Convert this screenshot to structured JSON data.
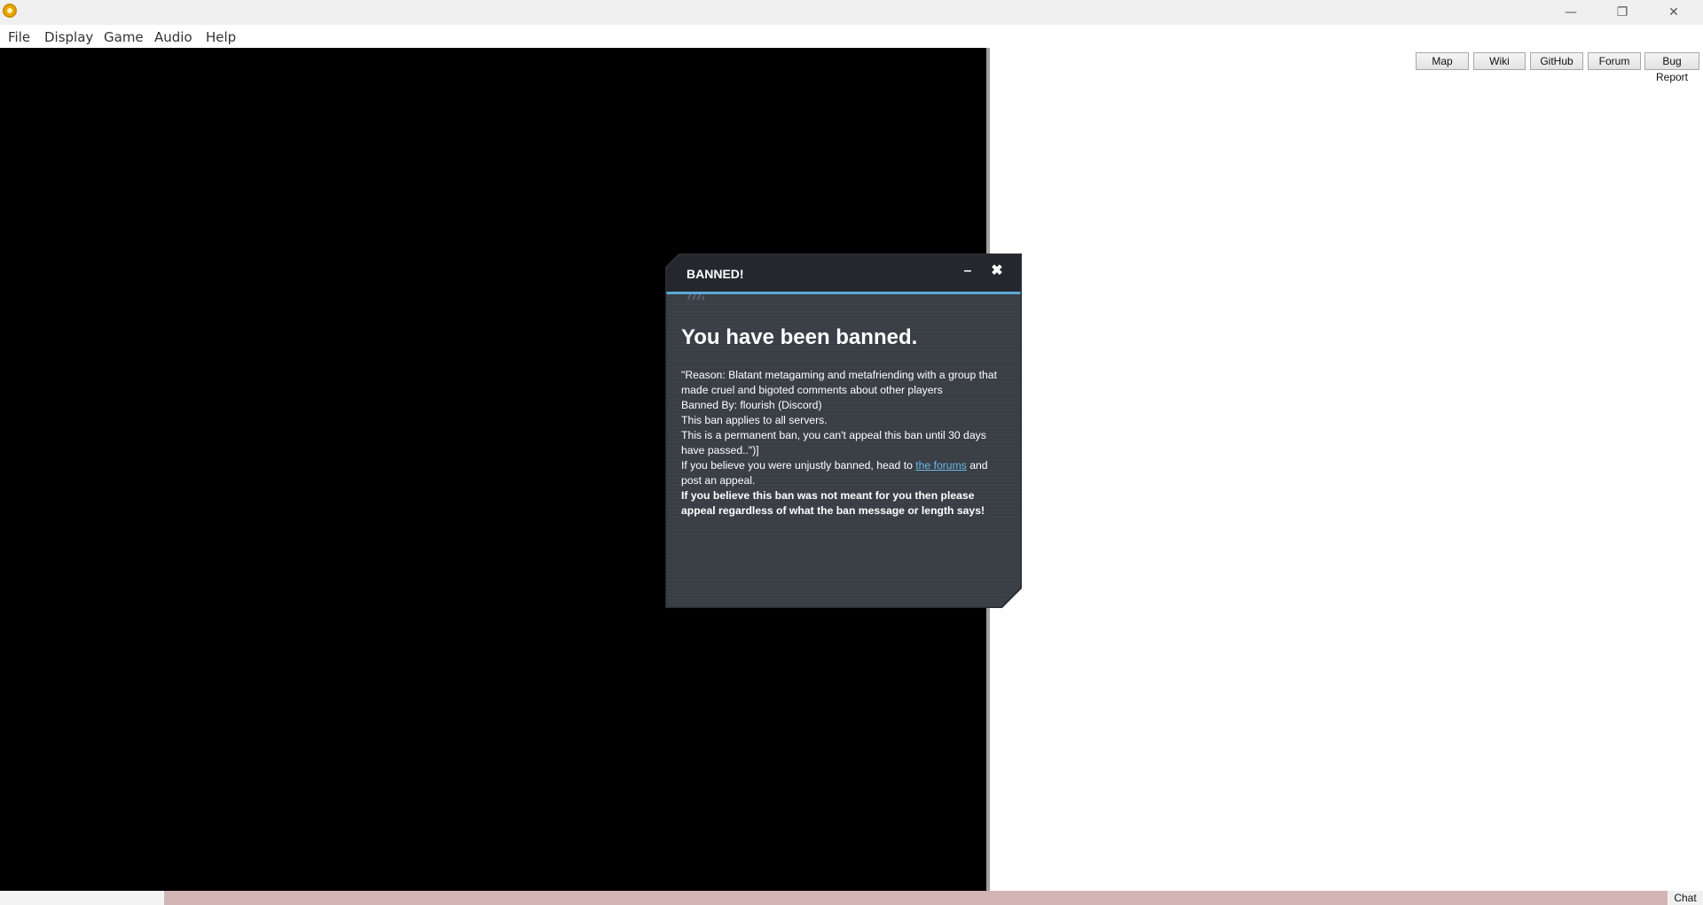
{
  "window": {
    "minimize_glyph": "—",
    "restore_glyph": "❐",
    "close_glyph": "✕"
  },
  "menu": [
    "File",
    "Display",
    "Game",
    "Audio",
    "Help"
  ],
  "link_buttons": [
    "Map",
    "Wiki",
    "GitHub",
    "Forum",
    "Bug Report"
  ],
  "statusbar": {
    "chat_label": "Chat"
  },
  "dialog": {
    "title": "BANNED!",
    "minimize_glyph": "–",
    "close_glyph": "✖",
    "heading": "You have been banned.",
    "lines": [
      "\"Reason: Blatant metagaming and metafriending with a group that made cruel and bigoted comments about other players",
      "Banned By: flourish (Discord)",
      "This ban applies to all servers.",
      "This is a permanent ban, you can't appeal this ban until 30 days have passed..\")]"
    ],
    "appeal_prefix": "If you believe you were unjustly banned, head to ",
    "appeal_link": "the forums",
    "appeal_suffix": " and post an appeal.",
    "warning": "If you believe this ban was not meant for you then please appeal regardless of what the ban message or length says!"
  },
  "colors": {
    "accent": "#5aa9d6",
    "dialog_bg": "#3c4148",
    "dialog_header": "#24282e",
    "link": "#6ab7e8",
    "statusbar": "#d3b4b4"
  }
}
